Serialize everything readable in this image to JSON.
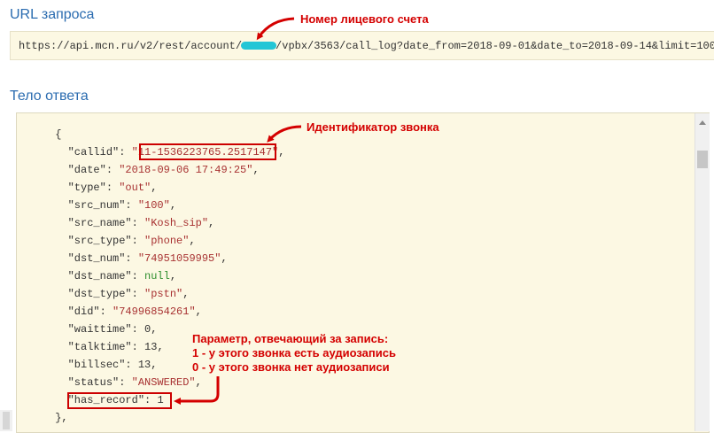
{
  "url_section": {
    "title": "URL запроса",
    "url_prefix": "https://api.mcn.ru/v2/rest/account/",
    "url_suffix": "/vpbx/3563/call_log?date_from=2018-09-01&date_to=2018-09-14&limit=100"
  },
  "response_section": {
    "title": "Тело ответа",
    "lines": [
      {
        "indent": "      ",
        "open": "{"
      },
      {
        "indent": "        ",
        "key": "\"callid\"",
        "type": "str",
        "value": "\"11-1536223765.2517147\"",
        "end": ","
      },
      {
        "indent": "        ",
        "key": "\"date\"",
        "type": "str",
        "value": "\"2018-09-06 17:49:25\"",
        "end": ","
      },
      {
        "indent": "        ",
        "key": "\"type\"",
        "type": "str",
        "value": "\"out\"",
        "end": ","
      },
      {
        "indent": "        ",
        "key": "\"src_num\"",
        "type": "str",
        "value": "\"100\"",
        "end": ","
      },
      {
        "indent": "        ",
        "key": "\"src_name\"",
        "type": "str",
        "value": "\"Kosh_sip\"",
        "end": ","
      },
      {
        "indent": "        ",
        "key": "\"src_type\"",
        "type": "str",
        "value": "\"phone\"",
        "end": ","
      },
      {
        "indent": "        ",
        "key": "\"dst_num\"",
        "type": "str",
        "value": "\"74951059995\"",
        "end": ","
      },
      {
        "indent": "        ",
        "key": "\"dst_name\"",
        "type": "nul",
        "value": "null",
        "end": ","
      },
      {
        "indent": "        ",
        "key": "\"dst_type\"",
        "type": "str",
        "value": "\"pstn\"",
        "end": ","
      },
      {
        "indent": "        ",
        "key": "\"did\"",
        "type": "str",
        "value": "\"74996854261\"",
        "end": ","
      },
      {
        "indent": "        ",
        "key": "\"waittime\"",
        "type": "num",
        "value": "0",
        "end": ","
      },
      {
        "indent": "        ",
        "key": "\"talktime\"",
        "type": "num",
        "value": "13",
        "end": ","
      },
      {
        "indent": "        ",
        "key": "\"billsec\"",
        "type": "num",
        "value": "13",
        "end": ","
      },
      {
        "indent": "        ",
        "key": "\"status\"",
        "type": "str",
        "value": "\"ANSWERED\"",
        "end": ","
      },
      {
        "indent": "        ",
        "key": "\"has_record\"",
        "type": "num",
        "value": "1",
        "end": ""
      },
      {
        "indent": "      ",
        "open": "},"
      }
    ]
  },
  "annotations": {
    "account_number": "Номер лицевого счета",
    "call_id": "Идентификатор звонка",
    "record_param": [
      "Параметр, отвечающий за запись:",
      "1 - у этого звонка есть аудиозапись",
      "0 - у этого звонка нет аудиозаписи"
    ]
  },
  "colors": {
    "title": "#2b6cb0",
    "panel_background": "#fcf8e3",
    "annotation_red": "#d40000",
    "string_value": "#a83232",
    "null_value": "#2f8f2f",
    "redaction": "#23c6d6"
  }
}
